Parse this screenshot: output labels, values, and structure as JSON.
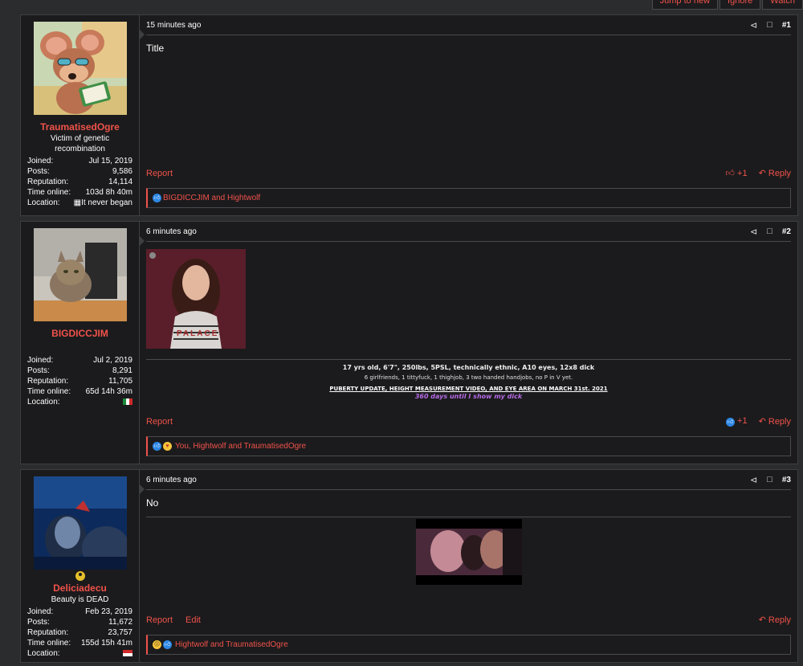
{
  "topbar": {
    "jump_label": "Jump to new",
    "ignore_label": "Ignore",
    "watch_label": "Watch"
  },
  "posts": [
    {
      "username": "TraumatisedOgre",
      "user_title": "Victim of genetic recombination",
      "stats": [
        {
          "label": "Joined:",
          "value": "Jul 15, 2019"
        },
        {
          "label": "Posts:",
          "value": "9,586"
        },
        {
          "label": "Reputation:",
          "value": "14,114"
        },
        {
          "label": "Time online:",
          "value": "103d 8h 40m"
        },
        {
          "label": "Location:",
          "value": "It never began"
        }
      ],
      "time": "15 minutes ago",
      "number": "#1",
      "body": "Title",
      "report_label": "Report",
      "like_count": "+1",
      "reply_label": "Reply",
      "likes_text": "BIGDICCJIM and Hightwolf"
    },
    {
      "username": "BIGDICCJIM",
      "stats": [
        {
          "label": "Joined:",
          "value": "Jul 2, 2019"
        },
        {
          "label": "Posts:",
          "value": "8,291"
        },
        {
          "label": "Reputation:",
          "value": "11,705"
        },
        {
          "label": "Time online:",
          "value": "65d 14h 36m"
        },
        {
          "label": "Location:",
          "value": ""
        }
      ],
      "time": "6 minutes ago",
      "number": "#2",
      "image_text": "PALACE",
      "signature": {
        "line1": "17 yrs old, 6'7\", 250lbs, 5PSL, technically ethnic, A10 eyes, 12x8 dick",
        "line2": "6 girlfriends, 1 tittyfuck, 1 thighjob, 3 two handed handjobs, no P in V yet.",
        "line3": "PUBERTY UPDATE, HEIGHT MEASUREMENT VIDEO, AND EYE AREA ON MARCH 31st. 2021",
        "line4": "360 days until I show my dick"
      },
      "report_label": "Report",
      "like_count": "+1",
      "reply_label": "Reply",
      "likes_text": "You, Hightwolf and TraumatisedOgre"
    },
    {
      "username": "Deliciadecu",
      "user_title": "Beauty is DEAD",
      "stats": [
        {
          "label": "Joined:",
          "value": "Feb 23, 2019"
        },
        {
          "label": "Posts:",
          "value": "11,672"
        },
        {
          "label": "Reputation:",
          "value": "23,757"
        },
        {
          "label": "Time online:",
          "value": "155d 15h 41m"
        },
        {
          "label": "Location:",
          "value": ""
        }
      ],
      "time": "6 minutes ago",
      "number": "#3",
      "body": "No",
      "report_label": "Report",
      "edit_label": "Edit",
      "reply_label": "Reply",
      "likes_text": "Hightwolf and TraumatisedOgre"
    }
  ],
  "colors": {
    "accent": "#f0524a",
    "background": "#2b2c2e",
    "panel": "#1b1b1d",
    "border": "#3e3f42",
    "signature_purple": "#b66be5",
    "like_blue": "#2d88e5"
  },
  "icons": [
    "share-icon",
    "bookmark-icon",
    "thumbs-up-icon",
    "reply-icon",
    "like-reaction-icon",
    "love-reaction-icon",
    "sad-reaction-icon",
    "mexico-flag-icon",
    "indonesia-flag-icon",
    "online-status-icon"
  ]
}
